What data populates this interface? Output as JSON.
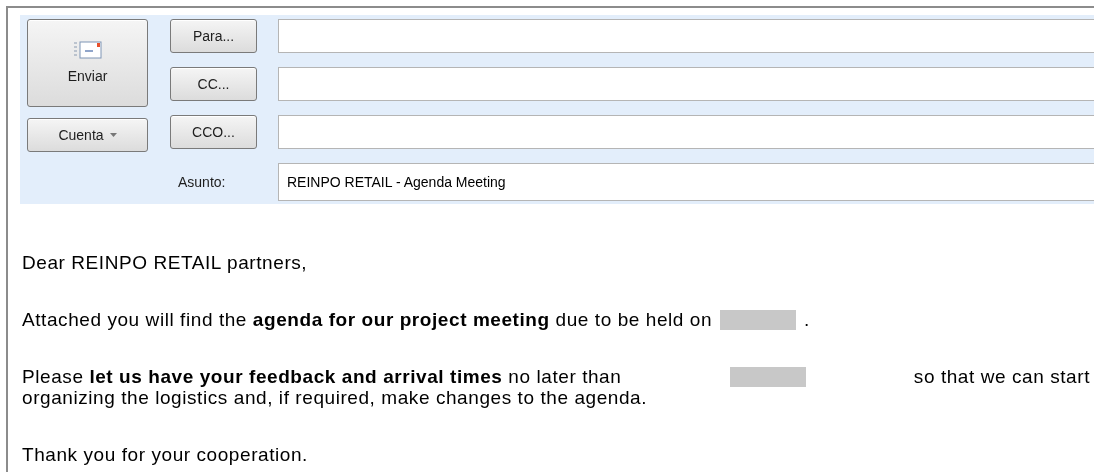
{
  "header": {
    "send_button": "Enviar",
    "account_button": "Cuenta",
    "address_rows": [
      {
        "button": "Para...",
        "value": ""
      },
      {
        "button": "CC...",
        "value": ""
      },
      {
        "button": "CCO...",
        "value": ""
      }
    ],
    "subject": {
      "label": "Asunto:",
      "value": "REINPO RETAIL - Agenda Meeting"
    }
  },
  "body": [
    {
      "lines": [
        [
          {
            "kind": "text",
            "text": "Dear REINPO RETAIL partners,"
          }
        ]
      ]
    },
    {
      "lines": [
        [
          {
            "kind": "text",
            "text": "Attached you will find the **agenda for our project meeting** due to be held on"
          },
          {
            "kind": "redacted"
          },
          {
            "kind": "text",
            "text": "."
          }
        ]
      ]
    },
    {
      "lines": [
        [
          {
            "kind": "text",
            "text": "Please **let us have your feedback and arrival times** no later than"
          },
          {
            "kind": "redacted"
          },
          {
            "kind": "text",
            "text": "so that we can start"
          }
        ],
        [
          {
            "kind": "text",
            "text": "organizing the logistics and, if required, make changes to the agenda."
          }
        ]
      ]
    },
    {
      "lines": [
        [
          {
            "kind": "text",
            "text": "Thank you for your cooperation."
          }
        ]
      ]
    }
  ]
}
